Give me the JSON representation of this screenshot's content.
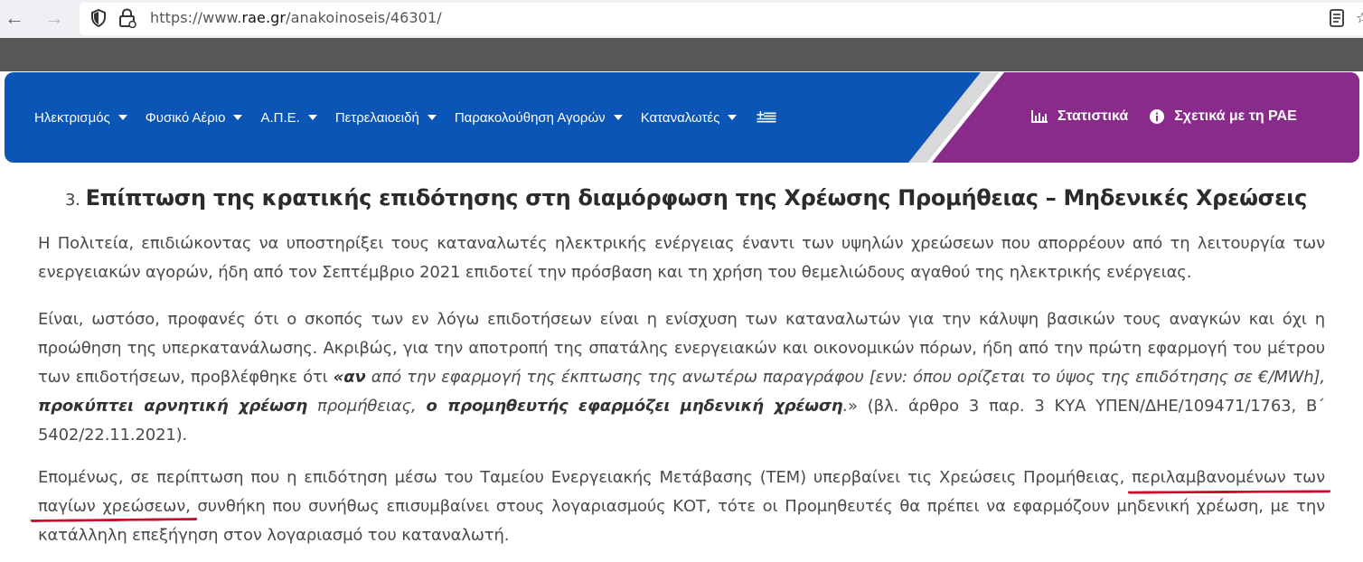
{
  "browser": {
    "url_prefix": "https://www.",
    "url_domain": "rae.gr",
    "url_path": "/anakoinoseis/46301/"
  },
  "nav": {
    "items": [
      {
        "label": "Ηλεκτρισμός"
      },
      {
        "label": "Φυσικό Αέριο"
      },
      {
        "label": "Α.Π.Ε."
      },
      {
        "label": "Πετρελαιοειδή"
      },
      {
        "label": "Παρακολούθηση Αγορών"
      },
      {
        "label": "Καταναλωτές"
      }
    ],
    "right": {
      "stats_label": "Στατιστικά",
      "about_label": "Σχετικά με τη ΡΑΕ"
    },
    "colors": {
      "blue": "#0a55b5",
      "purple": "#8a2a8a"
    }
  },
  "content": {
    "heading_number": "3.",
    "heading": "Επίπτωση της κρατικής επιδότησης στη διαμόρφωση της Χρέωσης Προμήθειας – Μηδενικές Χρεώσεις",
    "p1": "Η Πολιτεία, επιδιώκοντας να υποστηρίξει τους καταναλωτές ηλεκτρικής ενέργειας έναντι των υψηλών χρεώσεων που απορρέουν από τη λειτουργία των ενεργειακών αγορών, ήδη από τον Σεπτέμβριο 2021 επιδοτεί την πρόσβαση και τη χρήση του θεμελιώδους αγαθού της ηλεκτρικής ενέργειας.",
    "p2": {
      "a": "Είναι, ωστόσο, προφανές ότι ο σκοπός των εν λόγω επιδοτήσεων είναι η ενίσχυση των καταναλωτών για την κάλυψη βασικών τους αναγκών και όχι η προώθηση της υπερκατανάλωσης. Ακριβώς, για την αποτροπή της σπατάλης ενεργειακών και οικονομικών πόρων, ήδη από την πρώτη εφαρμογή του μέτρου των επιδοτήσεων, προβλέφθηκε ότι ",
      "b": "«αν",
      "c": " από την εφαρμογή της έκπτωσης της ανωτέρω παραγράφου [ενν: όπου ορίζεται το ύψος της επιδότησης σε €/MWh], ",
      "d": "προκύπτει αρνητική χρέωση",
      "e": " προμήθειας, ",
      "f": "ο προμηθευτής εφαρμόζει μηδενική χρέωση",
      "g": ".",
      "h": "» (βλ. άρθρο 3 παρ. 3 ΚΥΑ ΥΠΕΝ/ΔΗΕ/109471/1763, Β΄ 5402/22.11.2021)."
    },
    "p3": {
      "a": "Επομένως, σε περίπτωση που η επιδότηση μέσω του Ταμείου Ενεργειακής Μετάβασης (ΤΕΜ) υπερβαίνει τις Χρεώσεις Προμήθειας, ",
      "b": "περιλαμβανομένων των παγίων χρεώσεων,",
      "c": " συνθήκη που συνήθως επισυμβαίνει στους λογαριασμούς ΚΟΤ, τότε οι Προμηθευτές θα πρέπει να εφαρμόζουν μηδενική χρέωση, με την κατάλληλη επεξήγηση στον λογαριασμό του καταναλωτή."
    }
  }
}
